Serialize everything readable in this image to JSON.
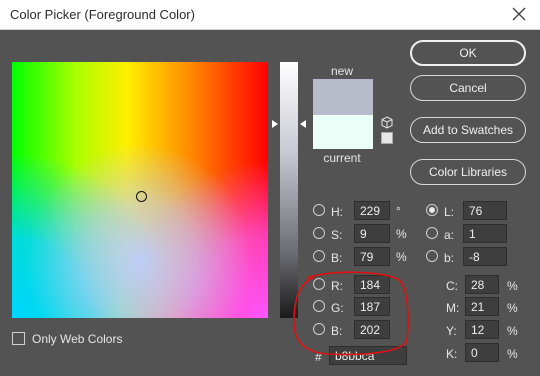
{
  "window": {
    "title": "Color Picker (Foreground Color)",
    "close_icon": "close-icon"
  },
  "buttons": {
    "ok": "OK",
    "cancel": "Cancel",
    "add_to_swatches": "Add to Swatches",
    "color_libraries": "Color Libraries"
  },
  "preview": {
    "new_label": "new",
    "current_label": "current",
    "new_color": "#b8bbca",
    "current_color": "#e9fff7",
    "gamut_icon": "cube-icon",
    "websafe_icon": "websafe-swatch-icon"
  },
  "hsb": [
    {
      "label": "H:",
      "value": "229",
      "unit": "°",
      "selected": false
    },
    {
      "label": "S:",
      "value": "9",
      "unit": "%",
      "selected": false
    },
    {
      "label": "B:",
      "value": "79",
      "unit": "%",
      "selected": false
    }
  ],
  "rgb": [
    {
      "label": "R:",
      "value": "184",
      "selected": false
    },
    {
      "label": "G:",
      "value": "187",
      "selected": false
    },
    {
      "label": "B:",
      "value": "202",
      "selected": false
    }
  ],
  "lab": [
    {
      "label": "L:",
      "value": "76",
      "selected": true
    },
    {
      "label": "a:",
      "value": "1",
      "selected": false
    },
    {
      "label": "b:",
      "value": "-8",
      "selected": false
    }
  ],
  "cmyk": [
    {
      "label": "C:",
      "value": "28",
      "unit": "%"
    },
    {
      "label": "M:",
      "value": "21",
      "unit": "%"
    },
    {
      "label": "Y:",
      "value": "12",
      "unit": "%"
    },
    {
      "label": "K:",
      "value": "0",
      "unit": "%"
    }
  ],
  "hex": {
    "label": "#",
    "value": "b8bbca"
  },
  "only_web_colors": {
    "label": "Only Web Colors",
    "checked": false
  },
  "annotation": {
    "color": "#e01010"
  }
}
